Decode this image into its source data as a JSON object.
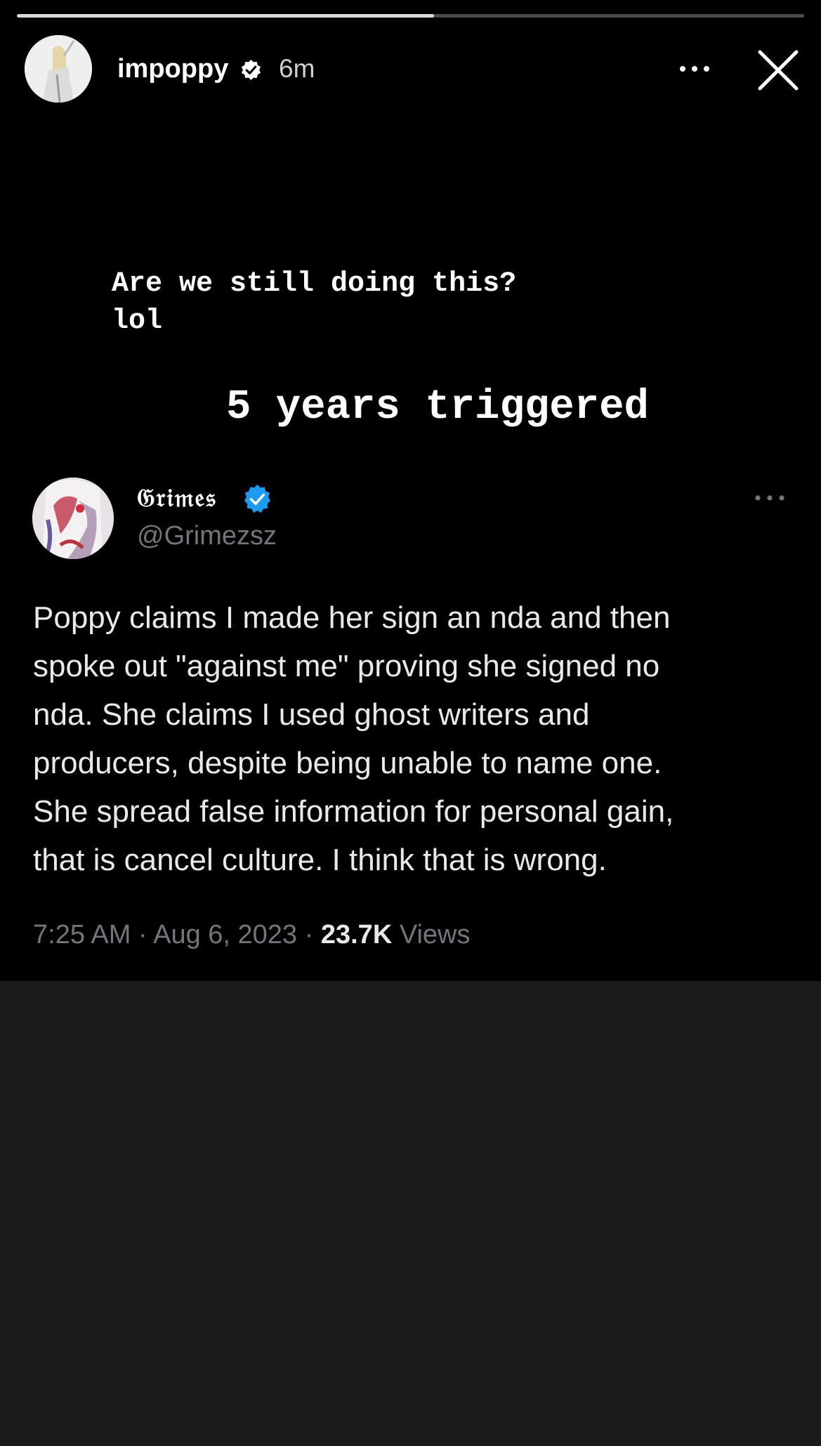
{
  "story": {
    "progress": 0.53,
    "username": "impoppy",
    "time": "6m",
    "caption_line1": "Are we still doing this?",
    "caption_line2": "lol",
    "caption_big": "5 years triggered"
  },
  "tweet": {
    "display_name": "𝔊𝔯𝔦𝔪𝔢𝔰",
    "handle": "@Grimezsz",
    "body": "Poppy claims I made her sign an nda and then\nspoke out \"against me\" proving she signed no\nnda.  She claims I used ghost writers and\nproducers, despite being unable to name one.\nShe spread false information for personal gain,\nthat is cancel culture.  I think that is wrong.",
    "time": "7:25 AM",
    "sep1": " · ",
    "date": "Aug 6, 2023",
    "sep2": " · ",
    "views_count": "23.7K",
    "views_label": " Views"
  },
  "colors": {
    "story_bg": "#000000",
    "page_bg": "#1b1b1b",
    "verified_blue": "#1d9bf0",
    "secondary_text": "#71767b"
  },
  "icons": [
    "verified-badge-icon",
    "more-options-icon",
    "close-icon",
    "twitter-verified-icon",
    "tweet-more-icon"
  ]
}
